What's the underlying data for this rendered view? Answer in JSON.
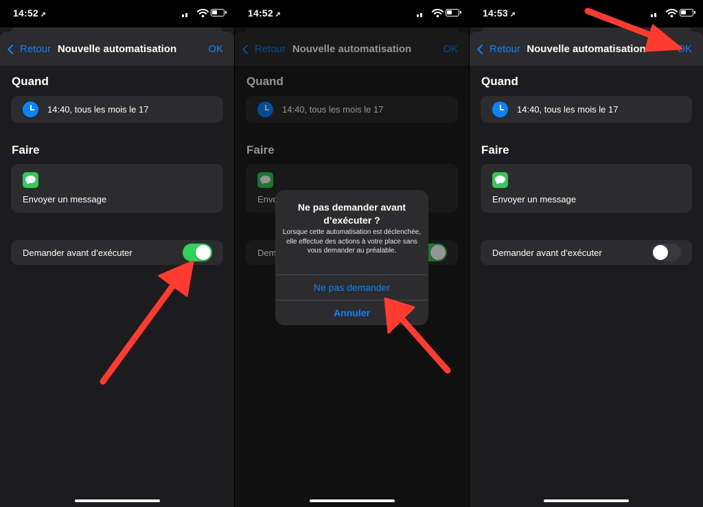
{
  "colors": {
    "accent": "#0a84ff",
    "toggle_on": "#30d158",
    "messages_green": "#34c759",
    "annotation_red": "#ff3b30"
  },
  "panels": [
    {
      "status": {
        "time": "14:52",
        "location_glyph": "➚"
      },
      "nav": {
        "back_label": "Retour",
        "title": "Nouvelle automatisation",
        "ok_label": "OK"
      },
      "when": {
        "heading": "Quand",
        "trigger_text": "14:40, tous les mois le 17",
        "icon": "clock-icon"
      },
      "do": {
        "heading": "Faire",
        "action_text": "Envoyer un message",
        "icon": "messages-icon"
      },
      "ask": {
        "label": "Demander avant d’exécuter",
        "toggle_on": true
      }
    },
    {
      "status": {
        "time": "14:52",
        "location_glyph": "➚"
      },
      "nav": {
        "back_label": "Retour",
        "title": "Nouvelle automatisation",
        "ok_label": "OK"
      },
      "when": {
        "heading": "Quand",
        "trigger_text": "14:40, tous les mois le 17",
        "icon": "clock-icon"
      },
      "do": {
        "heading": "Faire",
        "action_text": "Envoyer un message",
        "action_text_visible": "Envo",
        "icon": "messages-icon"
      },
      "ask": {
        "label": "Demander avant d’exécuter",
        "label_visible": "Dem",
        "toggle_on": true
      },
      "alert": {
        "title": "Ne pas demander avant d’exécuter ?",
        "message": "Lorsque cette automatisation est déclenchée, elle effectue des actions à votre place sans vous demander au préalable.",
        "primary_button": "Ne pas demander",
        "cancel_button": "Annuler"
      }
    },
    {
      "status": {
        "time": "14:53",
        "location_glyph": "➚"
      },
      "nav": {
        "back_label": "Retour",
        "title": "Nouvelle automatisation",
        "ok_label": "OK"
      },
      "when": {
        "heading": "Quand",
        "trigger_text": "14:40, tous les mois le 17",
        "icon": "clock-icon"
      },
      "do": {
        "heading": "Faire",
        "action_text": "Envoyer un message",
        "icon": "messages-icon"
      },
      "ask": {
        "label": "Demander avant d’exécuter",
        "toggle_on": false
      }
    }
  ]
}
